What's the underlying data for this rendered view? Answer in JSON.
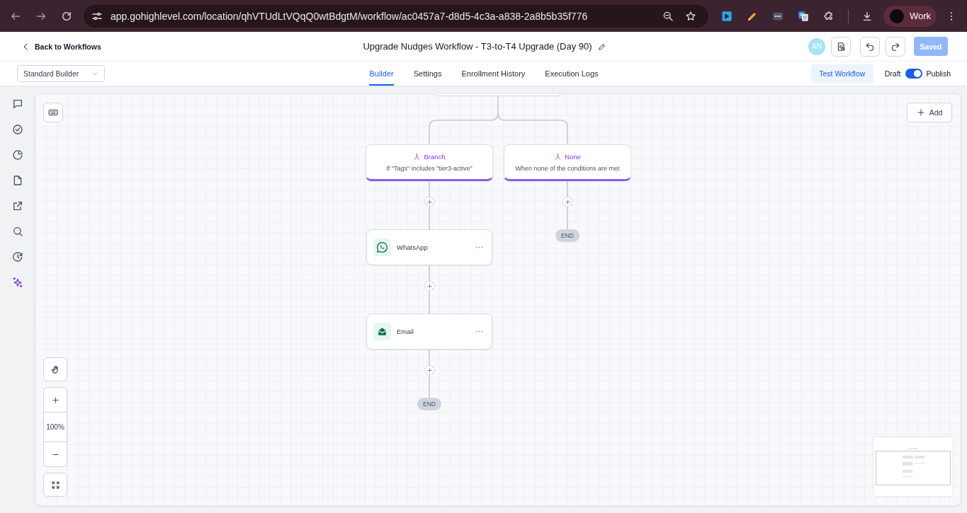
{
  "browser": {
    "url": "app.gohighlevel.com/location/qhVTUdLtVQqQ0wtBdgtM/workflow/ac0457a7-d8d5-4c3a-a838-2a8b5b35f776",
    "profile": "Work"
  },
  "header": {
    "back_link": "Back to Workflows",
    "title": "Upgrade Nudges Workflow - T3-to-T4 Upgrade (Day 90)",
    "avatar": "AN",
    "save_button": {
      "label": "Saved",
      "disabled": true
    }
  },
  "toolbar": {
    "builder_select": "Standard Builder",
    "tabs": [
      {
        "label": "Builder",
        "selected": true
      },
      {
        "label": "Settings",
        "selected": false
      },
      {
        "label": "Enrollment History",
        "selected": false
      },
      {
        "label": "Execution Logs",
        "selected": false
      }
    ],
    "test_button": "Test Workflow",
    "publish_toggle": {
      "off_label": "Draft",
      "on_label": "Publish",
      "on": true
    }
  },
  "canvas": {
    "add_button": "Add",
    "branches": [
      {
        "title": "Branch",
        "condition": "If \"Tags\" includes \"tier3-active\"",
        "steps": [
          {
            "kind": "whatsapp",
            "label": "WhatsApp"
          },
          {
            "kind": "email",
            "label": "Email"
          },
          {
            "kind": "end",
            "label": "END"
          }
        ]
      },
      {
        "title": "None",
        "condition": "When none of the conditions are met",
        "steps": [
          {
            "kind": "end",
            "label": "END"
          }
        ]
      }
    ],
    "zoom_label": "100%"
  }
}
